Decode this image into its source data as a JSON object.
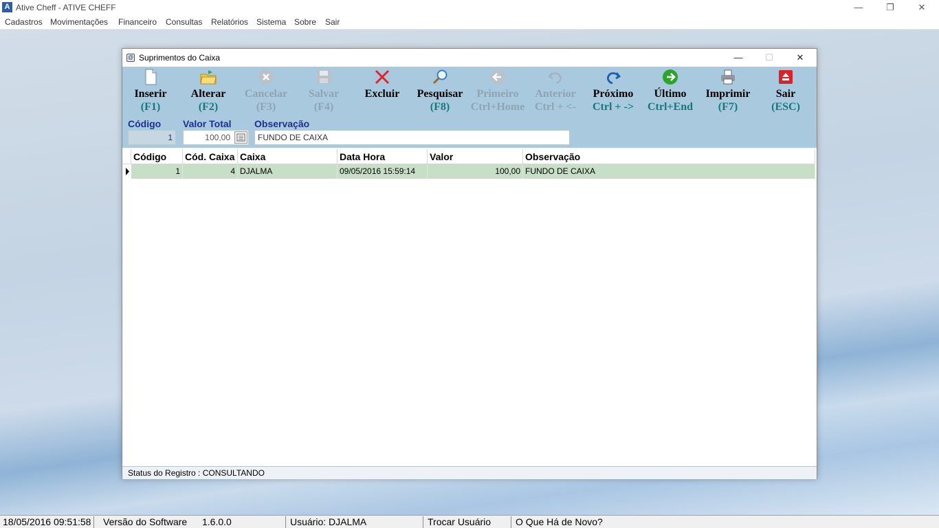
{
  "app": {
    "logo": "A",
    "title": "Ative Cheff - ATIVE CHEFF",
    "minimize_glyph": "—",
    "restore_glyph": "❐",
    "close_glyph": "✕"
  },
  "menu": [
    "Cadastros",
    "Movimentações",
    "Financeiro",
    "Consultas",
    "Relatórios",
    "Sistema",
    "Sobre",
    "Sair"
  ],
  "child": {
    "title": "Suprimentos do Caixa",
    "minimize_glyph": "—",
    "maximize_glyph": "☐",
    "close_glyph": "✕"
  },
  "toolbar": [
    {
      "label": "Inserir",
      "key": "(F1)",
      "icon": "new-document-icon",
      "enabled": true
    },
    {
      "label": "Alterar",
      "key": "(F2)",
      "icon": "folder-edit-icon",
      "enabled": true
    },
    {
      "label": "Cancelar",
      "key": "(F3)",
      "icon": "cancel-icon",
      "enabled": false
    },
    {
      "label": "Salvar",
      "key": "(F4)",
      "icon": "save-icon",
      "enabled": false
    },
    {
      "label": "Excluir",
      "key": "",
      "icon": "delete-x-icon",
      "enabled": true
    },
    {
      "label": "Pesquisar",
      "key": "(F8)",
      "icon": "search-icon",
      "enabled": true
    },
    {
      "label": "Primeiro",
      "key": "Ctrl+Home",
      "icon": "first-arrow-icon",
      "enabled": false
    },
    {
      "label": "Anterior",
      "key": "Ctrl + <-",
      "icon": "previous-arrow-icon",
      "enabled": false
    },
    {
      "label": "Próximo",
      "key": "Ctrl + ->",
      "icon": "next-arrow-icon",
      "enabled": true
    },
    {
      "label": "Último",
      "key": "Ctrl+End",
      "icon": "last-arrow-icon",
      "enabled": true
    },
    {
      "label": "Imprimir",
      "key": "(F7)",
      "icon": "printer-icon",
      "enabled": true
    },
    {
      "label": "Sair",
      "key": "(ESC)",
      "icon": "exit-icon",
      "enabled": true
    }
  ],
  "form": {
    "codigo_label": "Código",
    "codigo_value": "1",
    "valor_label": "Valor Total",
    "valor_value": "100,00",
    "obs_label": "Observação",
    "obs_value": "FUNDO DE CAIXA"
  },
  "grid": {
    "columns": [
      "Código",
      "Cód. Caixa",
      "Caixa",
      "Data Hora",
      "Valor",
      "Observação"
    ],
    "rows": [
      [
        "1",
        "4",
        "DJALMA",
        "09/05/2016 15:59:14",
        "100,00",
        "FUNDO DE CAIXA"
      ]
    ]
  },
  "status": "Status do Registro : CONSULTANDO",
  "bottom": {
    "datetime": "18/05/2016 09:51:58",
    "version_label": "Versão do Software",
    "version": "1.6.0.0",
    "user": "Usuário: DJALMA",
    "switch_user": "Trocar Usuário",
    "whats_new": "O Que Há de Novo?"
  },
  "colors": {
    "toolbar_bg": "#a9c9de",
    "selected_row": "#c6dfc6",
    "label_blue": "#1d2f8f",
    "shortcut_teal": "#137a7a"
  }
}
